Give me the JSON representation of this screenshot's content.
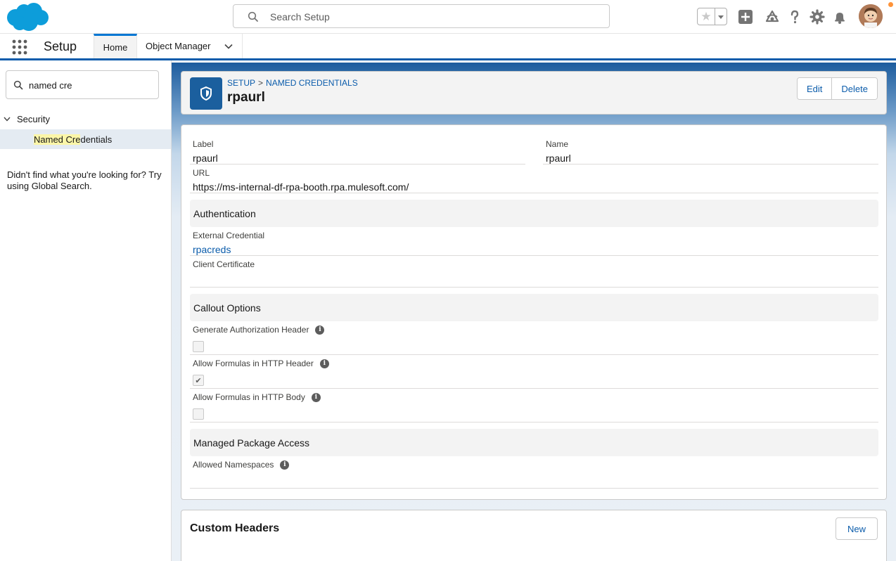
{
  "header": {
    "search_placeholder": "Search Setup",
    "icons": [
      "cloud-logo",
      "search-icon",
      "star-icon",
      "chevron-down-icon",
      "add-icon",
      "trailhead-icon",
      "help-icon",
      "gear-icon",
      "bell-icon",
      "avatar"
    ],
    "notification_color": "#fe9339"
  },
  "nav": {
    "app_name": "Setup",
    "tabs": [
      {
        "label": "Home",
        "active": true
      },
      {
        "label": "Object Manager",
        "active": false
      }
    ]
  },
  "sidebar": {
    "quick_find_value": "named cre",
    "section": "Security",
    "item_highlight": "Named Cre",
    "item_rest": "dentials",
    "not_found": "Didn't find what you're looking for? Try using Global Search."
  },
  "page_header": {
    "breadcrumb_root": "SETUP",
    "breadcrumb_sep": ">",
    "breadcrumb_current": "NAMED CREDENTIALS",
    "title": "rpaurl",
    "edit_label": "Edit",
    "delete_label": "Delete"
  },
  "detail": {
    "label_label": "Label",
    "label_value": "rpaurl",
    "name_label": "Name",
    "name_value": "rpaurl",
    "url_label": "URL",
    "url_value": "https://ms-internal-df-rpa-booth.rpa.mulesoft.com/",
    "auth_section": "Authentication",
    "ext_cred_label": "External Credential",
    "ext_cred_value": "rpacreds",
    "client_cert_label": "Client Certificate",
    "callout_section": "Callout Options",
    "gen_auth_label": "Generate Authorization Header",
    "gen_auth_checked": false,
    "formulas_header_label": "Allow Formulas in HTTP Header",
    "formulas_header_checked": true,
    "formulas_body_label": "Allow Formulas in HTTP Body",
    "formulas_body_checked": false,
    "managed_section": "Managed Package Access",
    "namespaces_label": "Allowed Namespaces"
  },
  "custom_headers": {
    "title": "Custom Headers",
    "new_label": "New"
  },
  "colors": {
    "brand": "#0176d3",
    "link": "#0b5cab",
    "icon_bg": "#1b5f9e"
  }
}
